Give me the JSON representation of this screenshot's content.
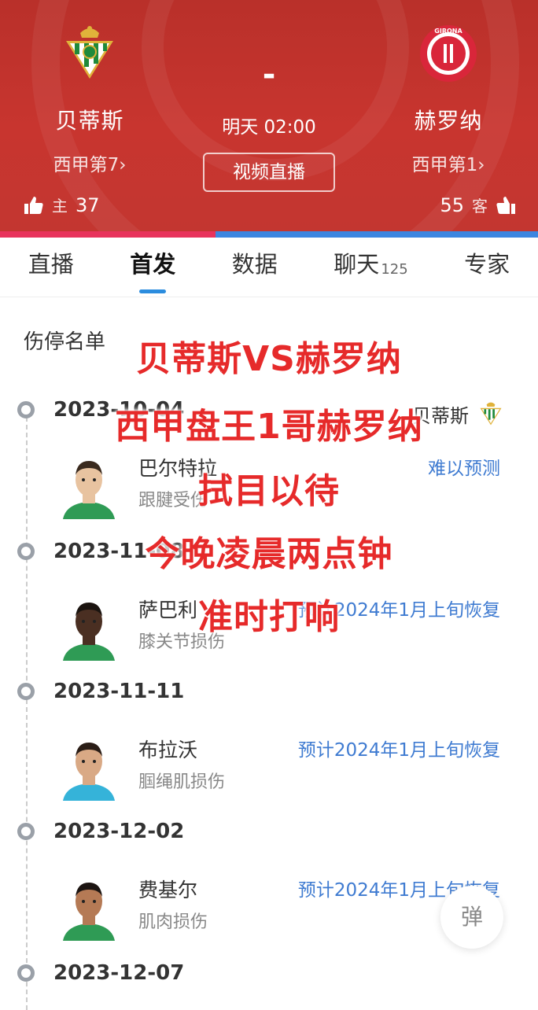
{
  "match": {
    "home": {
      "name": "贝蒂斯",
      "rank": "西甲第7",
      "vote_label": "主",
      "votes": "37",
      "crest": "betis-crest-icon"
    },
    "away": {
      "name": "赫罗纳",
      "rank": "西甲第1",
      "vote_label": "客",
      "votes": "55",
      "crest": "girona-crest-icon",
      "crest_text": "GIRONA"
    },
    "score": "-",
    "kickoff": "明天 02:00",
    "live_button": "视频直播",
    "vote_share_home": 0.4,
    "colors": {
      "header": "#c8352f",
      "home_bar": "#e8335c",
      "away_bar": "#3d86e0",
      "accent": "#2b8cde"
    }
  },
  "tabs": [
    {
      "label": "直播",
      "badge": ""
    },
    {
      "label": "首发",
      "badge": ""
    },
    {
      "label": "数据",
      "badge": ""
    },
    {
      "label": "聊天",
      "badge": "125"
    },
    {
      "label": "专家",
      "badge": ""
    }
  ],
  "active_tab": "首发",
  "injury_list": {
    "title": "伤停名单",
    "team_tag": "贝蒂斯",
    "groups": [
      {
        "date": "2023-10-04",
        "player": "巴尔特拉",
        "injury": "跟腱受伤",
        "recovery": "难以预测"
      },
      {
        "date": "2023-11-08",
        "player": "萨巴利",
        "injury": "膝关节损伤",
        "recovery": "预计2024年1月上旬恢复"
      },
      {
        "date": "2023-11-11",
        "player": "布拉沃",
        "injury": "腘绳肌损伤",
        "recovery": "预计2024年1月上旬恢复"
      },
      {
        "date": "2023-12-02",
        "player": "费基尔",
        "injury": "肌肉损伤",
        "recovery": "预计2024年1月上旬恢复"
      },
      {
        "date": "2023-12-07"
      }
    ]
  },
  "overlay_caption": [
    "贝蒂斯VS赫罗纳",
    "西甲盘王1哥赫罗纳",
    "拭目以待",
    "今晚凌晨两点钟",
    "准时打响"
  ],
  "float_button": "弹"
}
